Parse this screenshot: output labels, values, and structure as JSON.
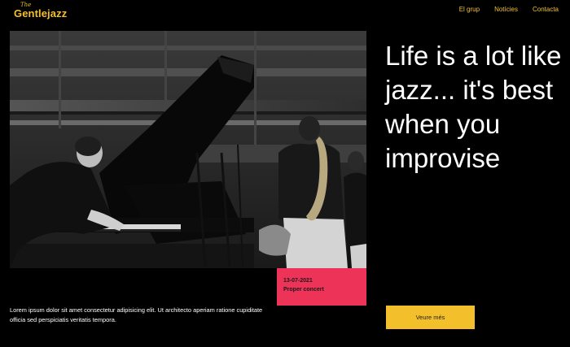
{
  "header": {
    "logo_small": "The",
    "logo_name": "Gentlejazz",
    "nav": [
      {
        "label": "El grup"
      },
      {
        "label": "Notícies"
      },
      {
        "label": "Contacta"
      }
    ]
  },
  "hero": {
    "headline": "Life is a lot like jazz... it's best when you improvise",
    "image_alt": "Black and white photo of a pianist and a saxophonist performing"
  },
  "event_card": {
    "date": "13-07-2021",
    "title": "Proper concert"
  },
  "intro": {
    "text": "Lorem ipsum dolor sit amet consectetur adipisicing elit. Ut architecto aperiam ratione cupiditate officia sed perspiciatis veritatis tempora."
  },
  "cta": {
    "label": "Veure més"
  },
  "colors": {
    "accent": "#f3c02c",
    "card": "#ee3358",
    "background": "#000000"
  }
}
